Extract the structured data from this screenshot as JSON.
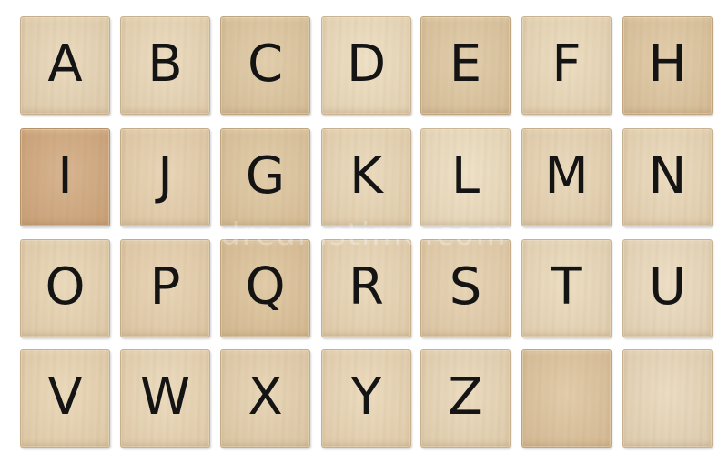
{
  "tiles": [
    {
      "letter": "A",
      "color": "#e6d5b8"
    },
    {
      "letter": "B",
      "color": "#e8d7ba"
    },
    {
      "letter": "C",
      "color": "#dcc6a2"
    },
    {
      "letter": "D",
      "color": "#ebdcc0"
    },
    {
      "letter": "E",
      "color": "#dcc6a2"
    },
    {
      "letter": "F",
      "color": "#e9d9bc"
    },
    {
      "letter": "H",
      "color": "#dcc5a1"
    },
    {
      "letter": "I",
      "color": "#cfa77f"
    },
    {
      "letter": "J",
      "color": "#e4cfaf"
    },
    {
      "letter": "G",
      "color": "#dcc5a0"
    },
    {
      "letter": "K",
      "color": "#e7d6b8"
    },
    {
      "letter": "L",
      "color": "#ecdec3"
    },
    {
      "letter": "M",
      "color": "#e6d4b6"
    },
    {
      "letter": "N",
      "color": "#e8d7ba"
    },
    {
      "letter": "O",
      "color": "#e6d4b5"
    },
    {
      "letter": "P",
      "color": "#e4cfaf"
    },
    {
      "letter": "Q",
      "color": "#dbc29c"
    },
    {
      "letter": "R",
      "color": "#e7d5b7"
    },
    {
      "letter": "S",
      "color": "#e3cfaf"
    },
    {
      "letter": "T",
      "color": "#e9d9bd"
    },
    {
      "letter": "U",
      "color": "#e9dac0"
    },
    {
      "letter": "V",
      "color": "#e6d4b4"
    },
    {
      "letter": "W",
      "color": "#e8d6b8"
    },
    {
      "letter": "X",
      "color": "#e3d0b0"
    },
    {
      "letter": "Y",
      "color": "#e8d6b8"
    },
    {
      "letter": "Z",
      "color": "#e7d6b9"
    },
    {
      "letter": "",
      "color": "#dcc39f"
    },
    {
      "letter": "",
      "color": "#e7d7bc"
    }
  ],
  "watermark": "dreamstime.com"
}
